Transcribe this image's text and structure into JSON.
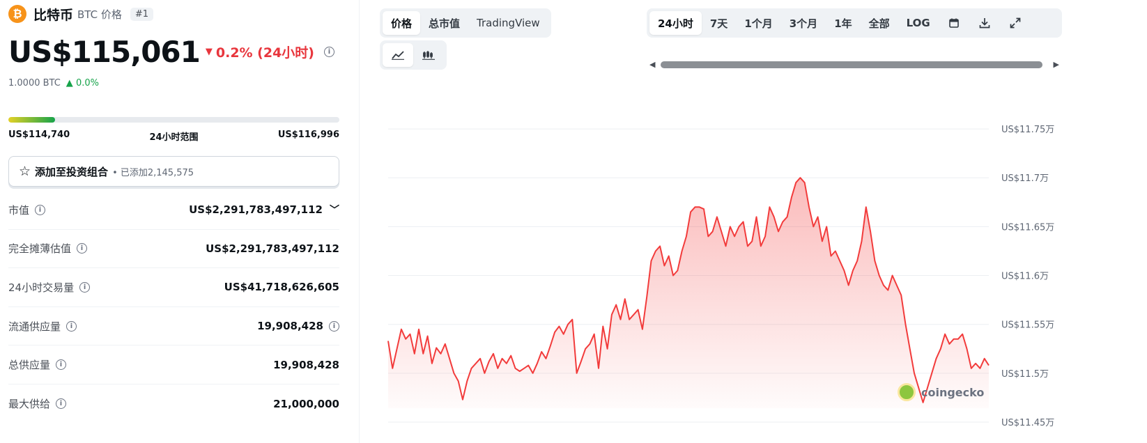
{
  "coin": {
    "logo": "₿",
    "name": "比特币",
    "sub": "BTC 价格",
    "rank": "#1",
    "price": "US$115,061",
    "change_24h": "0.2% (24小时)",
    "btc_amount": "1.0000 BTC",
    "btc_change": "0.0%",
    "range_low": "US$114,740",
    "range_label": "24小时范围",
    "range_high": "US$116,996",
    "range_position": 0.14
  },
  "portfolio": {
    "label": "添加至投资组合",
    "added": "• 已添加2,145,575"
  },
  "stats": [
    {
      "label": "市值",
      "value": "US$2,291,783,497,112"
    },
    {
      "label": "完全摊薄估值",
      "value": "US$2,291,783,497,112"
    },
    {
      "label": "24小时交易量",
      "value": "US$41,718,626,605"
    },
    {
      "label": "流通供应量",
      "value": "19,908,428"
    },
    {
      "label": "总供应量",
      "value": "19,908,428"
    },
    {
      "label": "最大供给",
      "value": "21,000,000"
    }
  ],
  "chart_tabs": [
    "价格",
    "总市值",
    "TradingView"
  ],
  "chart_style_icons": [
    "line-chart-icon",
    "candlestick-icon"
  ],
  "range_tabs": [
    "24小时",
    "7天",
    "1个月",
    "3个月",
    "1年",
    "全部",
    "LOG"
  ],
  "toolbar_icons": [
    "calendar-icon",
    "download-icon",
    "expand-icon"
  ],
  "watermark": "coingecko",
  "colors": {
    "down": "#e8363d",
    "up": "#16a34a",
    "brand": "#f7931a",
    "line": "#f23b3b"
  },
  "chart_data": {
    "type": "area",
    "ylim": [
      114500,
      117750
    ],
    "y_ticks": [
      "US$11.45万",
      "US$11.5万",
      "US$11.55万",
      "US$11.6万",
      "US$11.65万",
      "US$11.7万",
      "US$11.75万"
    ],
    "y_tick_values": [
      114500,
      115000,
      115500,
      116000,
      116500,
      117000,
      117500
    ],
    "grid": true,
    "series": [
      {
        "values": [
          115330,
          115050,
          115250,
          115450,
          115350,
          115400,
          115200,
          115450,
          115200,
          115380,
          115100,
          115260,
          115200,
          115300,
          115150,
          115000,
          114920,
          114730,
          114920,
          115050,
          115100,
          115150,
          115000,
          115120,
          115200,
          115050,
          115150,
          115100,
          115180,
          115050,
          115020,
          115050,
          115080,
          115000,
          115100,
          115220,
          115150,
          115280,
          115420,
          115480,
          115400,
          115500,
          115550,
          115000,
          115120,
          115250,
          115300,
          115400,
          115050,
          115480,
          115250,
          115600,
          115700,
          115550,
          115760,
          115550,
          115600,
          115650,
          115450,
          115780,
          116150,
          116250,
          116300,
          116100,
          116200,
          116000,
          116050,
          116250,
          116400,
          116650,
          116700,
          116700,
          116680,
          116400,
          116450,
          116600,
          116450,
          116300,
          116500,
          116400,
          116500,
          116550,
          116300,
          116350,
          116600,
          116300,
          116400,
          116700,
          116600,
          116450,
          116550,
          116600,
          116800,
          116950,
          117000,
          116950,
          116700,
          116500,
          116600,
          116350,
          116500,
          116200,
          116250,
          116150,
          116050,
          115900,
          116050,
          116150,
          116350,
          116700,
          116450,
          116150,
          116000,
          115900,
          115850,
          116000,
          115900,
          115800,
          115500,
          115250,
          115000,
          114850,
          114700,
          114850,
          115000,
          115150,
          115250,
          115400,
          115300,
          115350,
          115350,
          115400,
          115250,
          115050,
          115100,
          115050,
          115150,
          115080
        ]
      }
    ]
  }
}
